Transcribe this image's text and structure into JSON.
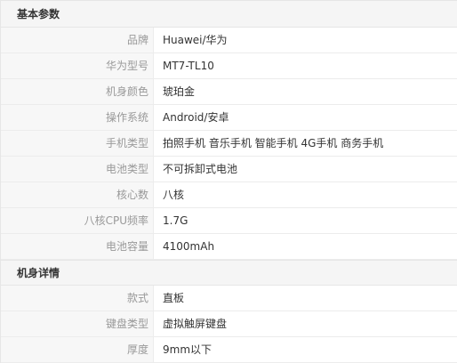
{
  "sections": [
    {
      "title": "基本参数",
      "rows": [
        {
          "label": "品牌",
          "value": "Huawei/华为"
        },
        {
          "label": "华为型号",
          "value": "MT7-TL10"
        },
        {
          "label": "机身颜色",
          "value": "琥珀金"
        },
        {
          "label": "操作系统",
          "value": "Android/安卓"
        },
        {
          "label": "手机类型",
          "value": "拍照手机 音乐手机 智能手机 4G手机 商务手机"
        },
        {
          "label": "电池类型",
          "value": "不可拆卸式电池"
        },
        {
          "label": "核心数",
          "value": "八核"
        },
        {
          "label": "八核CPU频率",
          "value": "1.7G"
        },
        {
          "label": "电池容量",
          "value": "4100mAh"
        }
      ]
    },
    {
      "title": "机身详情",
      "rows": [
        {
          "label": "款式",
          "value": "直板"
        },
        {
          "label": "键盘类型",
          "value": "虚拟触屏键盘"
        },
        {
          "label": "厚度",
          "value": "9mm以下"
        }
      ]
    }
  ]
}
